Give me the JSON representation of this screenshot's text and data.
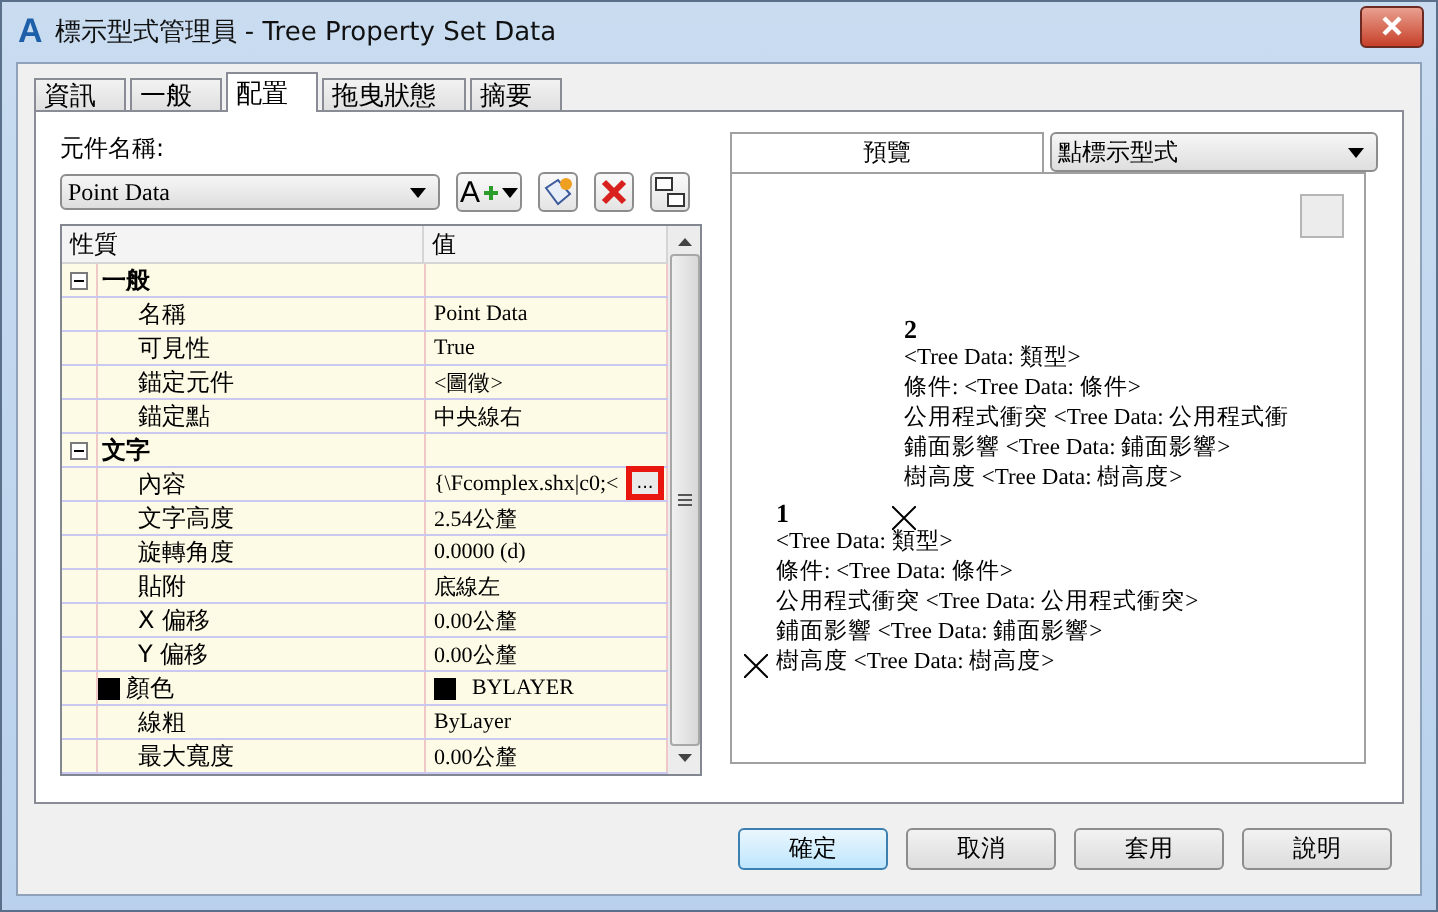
{
  "window": {
    "app_icon": "A",
    "title": "標示型式管理員 - Tree Property Set Data"
  },
  "tabs": [
    {
      "label": "資訊",
      "selected": false
    },
    {
      "label": "一般",
      "selected": false
    },
    {
      "label": "配置",
      "selected": true
    },
    {
      "label": "拖曳狀態",
      "selected": false
    },
    {
      "label": "摘要",
      "selected": false
    }
  ],
  "component": {
    "label": "元件名稱:",
    "value": "Point Data",
    "add_button_label": "A"
  },
  "grid": {
    "columns": [
      "性質",
      "值"
    ],
    "categories": [
      {
        "label": "一般",
        "expanded": true,
        "rows": [
          {
            "kind": "text",
            "name": "名稱",
            "value": "Point Data"
          },
          {
            "kind": "text",
            "name": "可見性",
            "value": "True"
          },
          {
            "kind": "text",
            "name": "錨定元件",
            "value": "<圖徵>"
          },
          {
            "kind": "text",
            "name": "錨定點",
            "value": "中央線右"
          }
        ]
      },
      {
        "label": "文字",
        "expanded": true,
        "rows": [
          {
            "kind": "edit",
            "name": "內容",
            "value": "{\\Fcomplex.shx|c0;<",
            "button": "..."
          },
          {
            "kind": "text",
            "name": "文字高度",
            "value": "2.54公釐"
          },
          {
            "kind": "text",
            "name": "旋轉角度",
            "value": "0.0000 (d)"
          },
          {
            "kind": "text",
            "name": "貼附",
            "value": "底線左"
          },
          {
            "kind": "text",
            "name": "X 偏移",
            "value": "0.00公釐"
          },
          {
            "kind": "text",
            "name": "Y 偏移",
            "value": "0.00公釐"
          },
          {
            "kind": "color",
            "name": "顏色",
            "value": "BYLAYER",
            "color": "#000000"
          },
          {
            "kind": "text",
            "name": "線粗",
            "value": "ByLayer"
          },
          {
            "kind": "text",
            "name": "最大寬度",
            "value": "0.00公釐"
          }
        ]
      }
    ]
  },
  "preview": {
    "label": "預覽",
    "style": "點標示型式",
    "labels": [
      {
        "number": "2",
        "lines": [
          "<Tree Data: 類型>",
          "條件:  <Tree Data: 條件>",
          "公用程式衝突  <Tree Data: 公用程式衝",
          "鋪面影響  <Tree Data: 鋪面影響>",
          "樹高度  <Tree Data: 樹高度>"
        ]
      },
      {
        "number": "1",
        "lines": [
          "<Tree Data: 類型>",
          "條件:  <Tree Data: 條件>",
          "公用程式衝突  <Tree Data: 公用程式衝突>",
          "鋪面影響  <Tree Data: 鋪面影響>",
          "樹高度  <Tree Data: 樹高度>"
        ]
      }
    ]
  },
  "buttons": [
    {
      "label": "確定",
      "default": true
    },
    {
      "label": "取消",
      "default": false
    },
    {
      "label": "套用",
      "default": false
    },
    {
      "label": "說明",
      "default": false
    }
  ]
}
